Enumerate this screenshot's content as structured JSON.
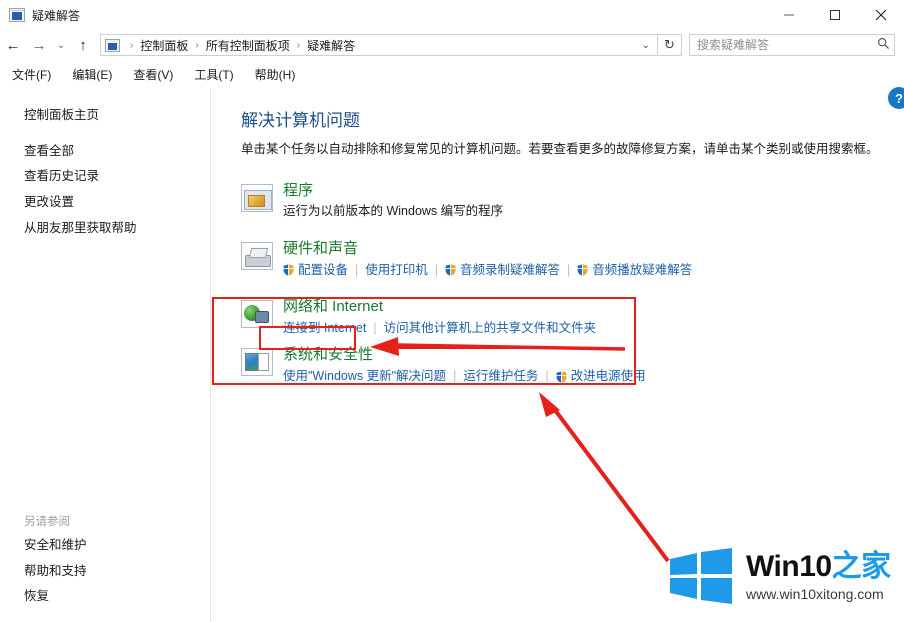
{
  "window": {
    "title": "疑难解答",
    "icon": "troubleshooting-icon",
    "minimize_label": "最小化",
    "maximize_label": "最大化",
    "close_label": "关闭"
  },
  "address_bar": {
    "back_label": "←",
    "forward_label": "→",
    "recent_label": "⌄",
    "up_label": "↑",
    "breadcrumb": [
      "控制面板",
      "所有控制面板项",
      "疑难解答"
    ],
    "separator": "›",
    "dropdown_caret": "⌄",
    "refresh_label": "↻"
  },
  "search": {
    "placeholder": "搜索疑难解答",
    "value": "",
    "icon": "search-icon"
  },
  "menu": {
    "items": [
      "文件(F)",
      "编辑(E)",
      "查看(V)",
      "工具(T)",
      "帮助(H)"
    ]
  },
  "sidebar": {
    "home": "控制面板主页",
    "items": [
      "查看全部",
      "查看历史记录",
      "更改设置",
      "从朋友那里获取帮助"
    ],
    "see_also_title": "另请参阅",
    "see_also_items": [
      "安全和维护",
      "帮助和支持",
      "恢复"
    ]
  },
  "main": {
    "help_icon_label": "?",
    "title": "解决计算机问题",
    "description": "单击某个任务以自动排除和修复常见的计算机问题。若要查看更多的故障修复方案，请单击某个类别或使用搜索框。",
    "categories": [
      {
        "icon": "program-window-icon",
        "title": "程序",
        "links": [
          {
            "text": "运行为以前版本的 Windows 编写的程序",
            "shield": false,
            "style": "plain"
          }
        ]
      },
      {
        "icon": "hardware-printer-icon",
        "title": "硬件和声音",
        "links": [
          {
            "text": "配置设备",
            "shield": true,
            "style": "link"
          },
          {
            "text": "使用打印机",
            "shield": false,
            "style": "link"
          },
          {
            "text": "音频录制疑难解答",
            "shield": true,
            "style": "link"
          },
          {
            "text": "音频播放疑难解答",
            "shield": true,
            "style": "link"
          }
        ]
      },
      {
        "icon": "network-globe-icon",
        "title": "网络和 Internet",
        "links": [
          {
            "text": "连接到 Internet",
            "shield": false,
            "style": "link",
            "highlighted": true
          },
          {
            "text": "访问其他计算机上的共享文件和文件夹",
            "shield": false,
            "style": "link"
          }
        ]
      },
      {
        "icon": "system-security-icon",
        "title": "系统和安全性",
        "links": [
          {
            "text": "使用\"Windows 更新\"解决问题",
            "shield": false,
            "style": "link"
          },
          {
            "text": "运行维护任务",
            "shield": false,
            "style": "link"
          },
          {
            "text": "改进电源使用",
            "shield": true,
            "style": "link"
          }
        ]
      }
    ]
  },
  "annotations": {
    "highlight_color": "#e8201c",
    "arrow_color": "#e8201c",
    "outer_box_target": "网络和 Internet",
    "inner_box_target": "连接到 Internet",
    "arrow_1_target": "连接到 Internet",
    "arrow_2_target": "改进电源使用"
  },
  "watermark": {
    "brand_en": "Win10",
    "brand_cn": "之家",
    "url": "www.win10xitong.com",
    "logo": "windows-logo-icon",
    "logo_color": "#1e9ae8"
  }
}
